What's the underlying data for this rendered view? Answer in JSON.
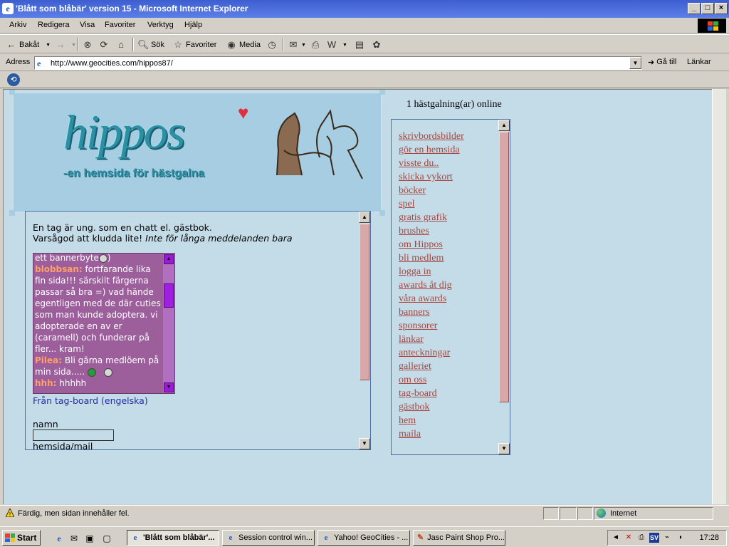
{
  "window": {
    "title": "'Blått som blåbär' version 15 - Microsoft Internet Explorer",
    "icon": "ie-icon",
    "buttons": [
      "minimize",
      "maximize",
      "close"
    ]
  },
  "menubar": {
    "items": [
      "Arkiv",
      "Redigera",
      "Visa",
      "Favoriter",
      "Verktyg",
      "Hjälp"
    ]
  },
  "toolbar": {
    "back_label": "Bakåt",
    "search_label": "Sök",
    "favorites_label": "Favoriter",
    "media_label": "Media"
  },
  "address": {
    "label": "Adress",
    "url": "http://www.geocities.com/hippos87/",
    "go_label": "Gå till",
    "links_label": "Länkar"
  },
  "page": {
    "banner": {
      "logo": "hippos",
      "tagline": "-en hemsida för hästgalna"
    },
    "online_text": "1 hästgalning(ar) online",
    "guestbook": {
      "intro_line1": "En tag är ung. som en chatt el. gästbok.",
      "intro_line2_plain": "Varsågod att kludda lite! ",
      "intro_line2_italic": "Inte för långa meddelanden bara",
      "messages": [
        {
          "name": "",
          "text": "ett bannerbyte"
        },
        {
          "name": "blobbsan:",
          "text": " fortfarande lika fin sida!!! särskilt färgerna passar så bra =) vad hände egentligen med de där cuties som man kunde adoptera. vi adopterade en av er (caramell) och funderar på fler... kram!"
        },
        {
          "name": "Pilea:",
          "text": " Bli gärna medlöem på min sida....."
        },
        {
          "name": "hhh:",
          "text": " hhhhh"
        }
      ],
      "from_label": "Från tag-board (engelska)",
      "name_label": "namn",
      "name_value": "",
      "homepage_label": "hemsida/mail"
    },
    "menu_links": [
      "skrivbordsbilder",
      "gör en hemsida",
      "visste du..",
      "skicka vykort",
      "böcker",
      "spel",
      "gratis grafik",
      "brushes",
      "om Hippos",
      "bli medlem",
      "logga in",
      "awards åt dig",
      "våra awards",
      "banners",
      "sponsorer",
      "länkar",
      "anteckningar",
      "galleriet",
      "om oss",
      "tag-board",
      "gästbok",
      "hem",
      "maila"
    ]
  },
  "statusbar": {
    "message": "Färdig, men sidan innehåller fel.",
    "zone": "Internet"
  },
  "taskbar": {
    "start_label": "Start",
    "tasks": [
      {
        "label": "'Blått som blåbär'...",
        "active": true,
        "icon": "ie-icon"
      },
      {
        "label": "Session control win...",
        "active": false,
        "icon": "ie-icon"
      },
      {
        "label": "Yahoo! GeoCities - ...",
        "active": false,
        "icon": "ie-icon"
      },
      {
        "label": "Jasc Paint Shop Pro...",
        "active": false,
        "icon": "paint-icon"
      }
    ],
    "tray_lang": "SV",
    "clock": "17:28"
  }
}
